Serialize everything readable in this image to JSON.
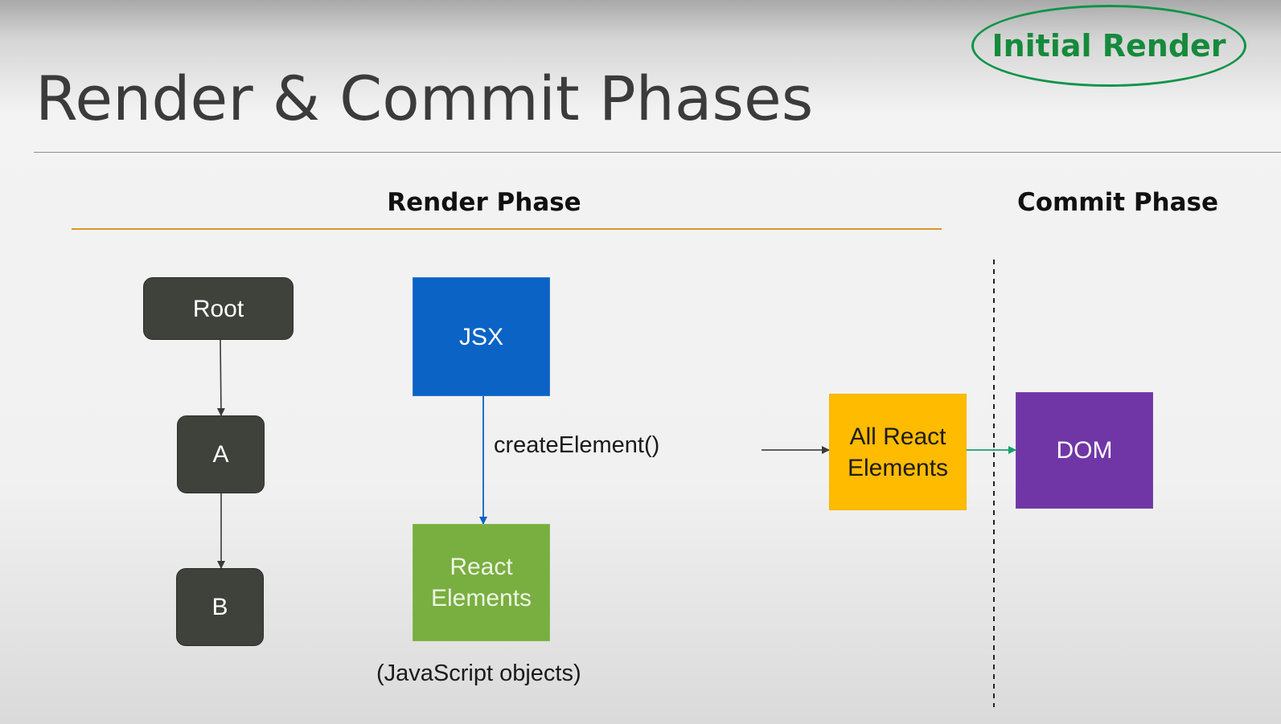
{
  "slide": {
    "title": "Render & Commit Phases",
    "badge": "Initial Render"
  },
  "phases": {
    "render": "Render Phase",
    "commit": "Commit Phase"
  },
  "tree": {
    "root": "Root",
    "a": "A",
    "b": "B"
  },
  "flow": {
    "jsx": "JSX",
    "create_element": "createElement()",
    "react_elements": "React Elements",
    "js_objects": "(JavaScript objects)",
    "all_react_elements": "All React Elements",
    "dom": "DOM"
  },
  "colors": {
    "tree_node": "#3e423b",
    "jsx": "#0b63c5",
    "react_elements": "#79ae41",
    "all_react_elements": "#ffbb00",
    "dom": "#7036a6",
    "badge": "#168a3c",
    "render_rule": "#d9962a",
    "commit_arrow": "#16a06b",
    "jsx_arrow": "#0b63c5"
  }
}
